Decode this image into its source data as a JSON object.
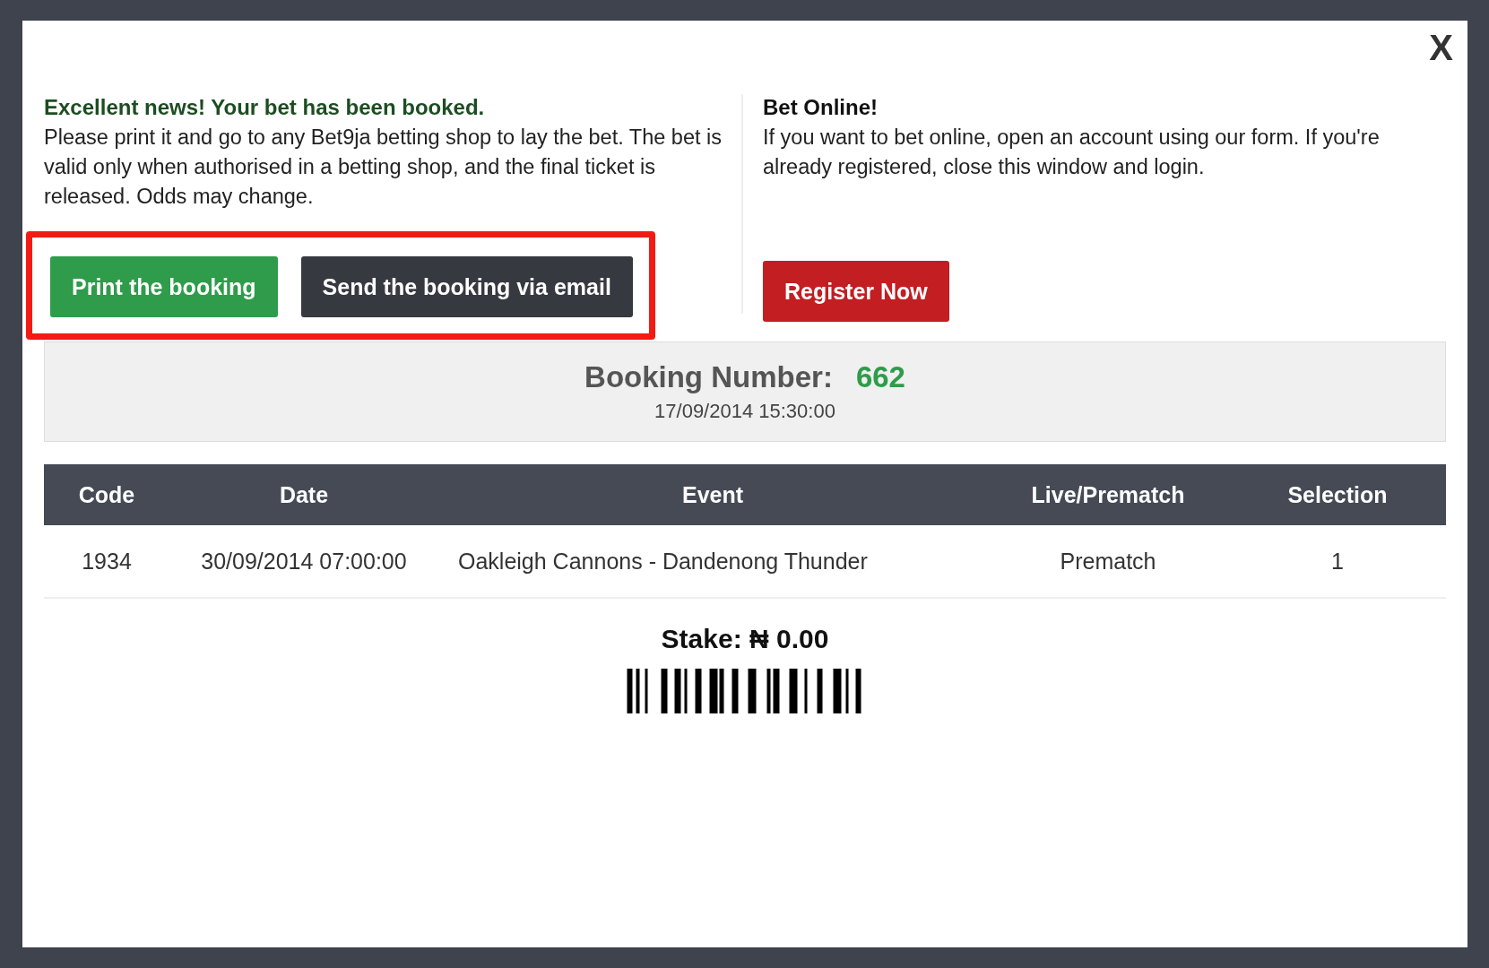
{
  "close": "X",
  "booked": {
    "heading": "Excellent news! Your bet has been booked.",
    "text": "Please print it and go to any Bet9ja betting shop to lay the bet. The bet is valid only when authorised in a betting shop, and the final ticket is released. Odds may change.",
    "highlighted": true,
    "buttons": [
      {
        "label": "Print the booking",
        "kind": "primary"
      },
      {
        "label": "Send the booking via email",
        "kind": "dark"
      }
    ]
  },
  "online": {
    "heading": "Bet Online!",
    "text": "If you want to bet online, open an account using our form. If you're already registered, close this window and login.",
    "button": "Register Now"
  },
  "booking": {
    "label": "Booking Number:",
    "number": "662",
    "datetime": "17/09/2014 15:30:00"
  },
  "table": {
    "columns": [
      "Code",
      "Date",
      "Event",
      "Live/Prematch",
      "Selection"
    ],
    "rows": [
      [
        "1934",
        "30/09/2014 07:00:00",
        "Oakleigh Cannons - Dandenong Thunder",
        "Prematch",
        "1"
      ]
    ]
  },
  "stake": "Stake: ₦ 0.00"
}
